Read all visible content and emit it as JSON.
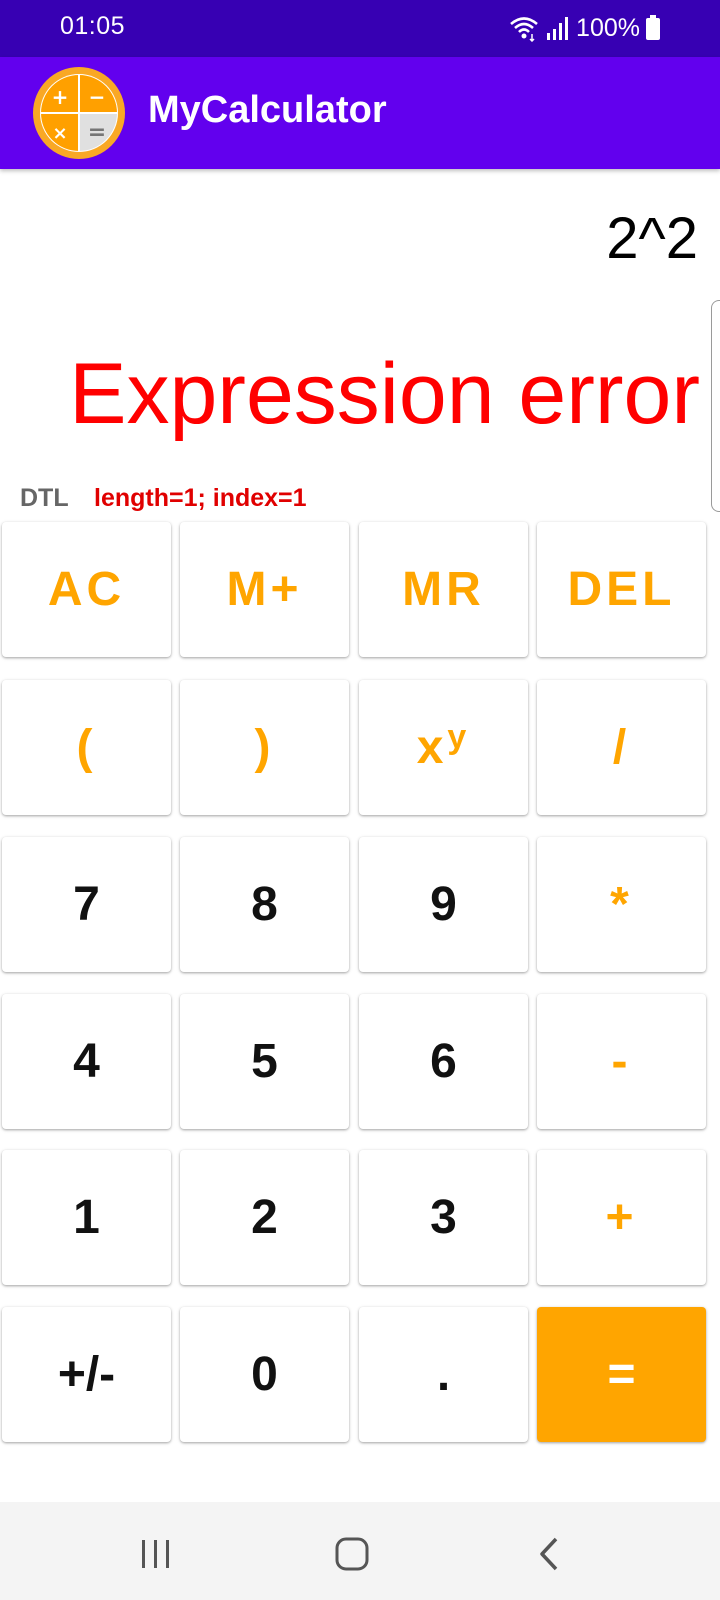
{
  "status": {
    "time": "01:05",
    "battery": "100%"
  },
  "appbar": {
    "title": "MyCalculator",
    "logo": {
      "plus": "+",
      "minus": "−",
      "times": "×",
      "equals": "="
    }
  },
  "display": {
    "expression": "2^2",
    "result": "Expression error",
    "dtl_label": "DTL",
    "dtl_text": "length=1; index=1"
  },
  "keys": {
    "ac": "AC",
    "mplus": "M+",
    "mr": "MR",
    "del": "DEL",
    "lparen": "(",
    "rparen": ")",
    "pow_base": "x",
    "pow_exp": "y",
    "divide": "/",
    "seven": "7",
    "eight": "8",
    "nine": "9",
    "multiply": "*",
    "four": "4",
    "five": "5",
    "six": "6",
    "minus": "-",
    "one": "1",
    "two": "2",
    "three": "3",
    "plus": "+",
    "negate": "+/-",
    "zero": "0",
    "dot": ".",
    "equals": "="
  },
  "colors": {
    "status_bar": "#3700B3",
    "app_bar": "#6200EE",
    "operator": "#FFA500",
    "error": "#FF0000"
  },
  "icons": {
    "wifi": "wifi-icon",
    "signal": "signal-icon",
    "battery": "battery-icon",
    "recents": "recents-icon",
    "home": "home-icon",
    "back": "back-icon"
  }
}
